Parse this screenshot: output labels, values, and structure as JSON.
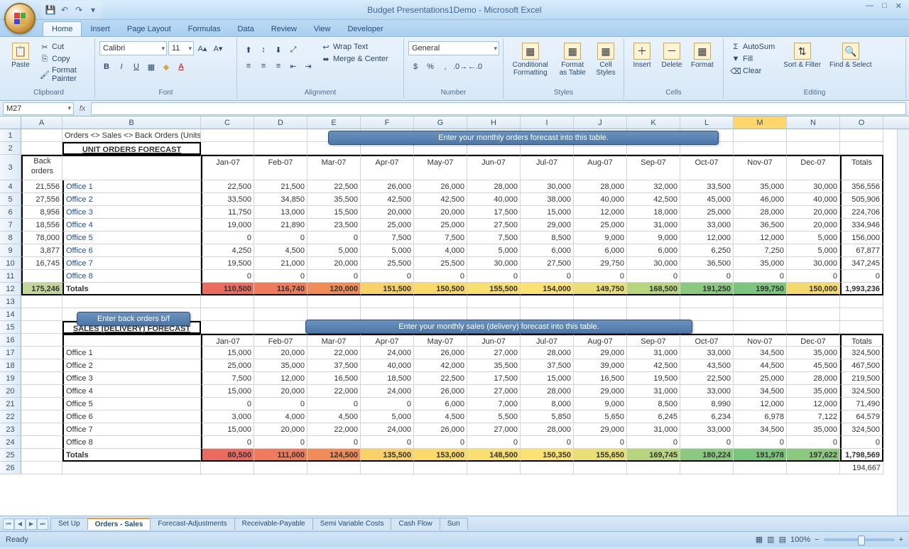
{
  "apptitle": "Budget Presentations1Demo - Microsoft Excel",
  "ribbon": {
    "tabs": [
      "Home",
      "Insert",
      "Page Layout",
      "Formulas",
      "Data",
      "Review",
      "View",
      "Developer"
    ],
    "activeTab": 0,
    "clipboard": {
      "paste": "Paste",
      "cut": "Cut",
      "copy": "Copy",
      "fmtpainter": "Format Painter",
      "label": "Clipboard"
    },
    "font": {
      "name": "Calibri",
      "size": "11",
      "label": "Font"
    },
    "alignment": {
      "wrap": "Wrap Text",
      "merge": "Merge & Center",
      "label": "Alignment"
    },
    "number": {
      "format": "General",
      "label": "Number"
    },
    "styles": {
      "cond": "Conditional\nFormatting",
      "fmttable": "Format\nas Table",
      "cellstyles": "Cell\nStyles",
      "label": "Styles"
    },
    "cells": {
      "insert": "Insert",
      "delete": "Delete",
      "format": "Format",
      "label": "Cells"
    },
    "editing": {
      "autosum": "AutoSum",
      "fill": "Fill",
      "clear": "Clear",
      "sort": "Sort &\nFilter",
      "find": "Find &\nSelect",
      "label": "Editing"
    }
  },
  "namebox": "M27",
  "cols": [
    "A",
    "B",
    "C",
    "D",
    "E",
    "F",
    "G",
    "H",
    "I",
    "J",
    "K",
    "L",
    "M",
    "N",
    "O"
  ],
  "months": [
    "Jan-07",
    "Feb-07",
    "Mar-07",
    "Apr-07",
    "May-07",
    "Jun-07",
    "Jul-07",
    "Aug-07",
    "Sep-07",
    "Oct-07",
    "Nov-07",
    "Dec-07"
  ],
  "section1_title": "Orders <> Sales <> Back Orders (Units)",
  "section1_box": "UNIT ORDERS FORECAST",
  "callout1": "Enter your monthly  orders forecast\ninto this table.",
  "backorders_hdr": "Back orders",
  "totals_hdr": "Totals",
  "orders": [
    {
      "back": "21,556",
      "name": "Office 1",
      "vals": [
        "22,500",
        "21,500",
        "22,500",
        "26,000",
        "26,000",
        "28,000",
        "30,000",
        "28,000",
        "32,000",
        "33,500",
        "35,000",
        "30,000"
      ],
      "total": "356,556"
    },
    {
      "back": "27,556",
      "name": "Office 2",
      "vals": [
        "33,500",
        "34,850",
        "35,500",
        "42,500",
        "42,500",
        "40,000",
        "38,000",
        "40,000",
        "42,500",
        "45,000",
        "46,000",
        "40,000"
      ],
      "total": "505,906"
    },
    {
      "back": "8,956",
      "name": "Office 3",
      "vals": [
        "11,750",
        "13,000",
        "15,500",
        "20,000",
        "20,000",
        "17,500",
        "15,000",
        "12,000",
        "18,000",
        "25,000",
        "28,000",
        "20,000"
      ],
      "total": "224,706"
    },
    {
      "back": "18,556",
      "name": "Office 4",
      "vals": [
        "19,000",
        "21,890",
        "23,500",
        "25,000",
        "25,000",
        "27,500",
        "29,000",
        "25,000",
        "31,000",
        "33,000",
        "36,500",
        "20,000"
      ],
      "total": "334,946"
    },
    {
      "back": "78,000",
      "name": "Office 5",
      "vals": [
        "0",
        "0",
        "0",
        "7,500",
        "7,500",
        "7,500",
        "8,500",
        "9,000",
        "9,000",
        "12,000",
        "12,000",
        "5,000"
      ],
      "total": "156,000"
    },
    {
      "back": "3,877",
      "name": "Office 6",
      "vals": [
        "4,250",
        "4,500",
        "5,000",
        "5,000",
        "4,000",
        "5,000",
        "6,000",
        "6,000",
        "6,000",
        "6,250",
        "7,250",
        "5,000"
      ],
      "total": "67,877"
    },
    {
      "back": "16,745",
      "name": "Office 7",
      "vals": [
        "19,500",
        "21,000",
        "20,000",
        "25,500",
        "25,500",
        "30,000",
        "27,500",
        "29,750",
        "30,000",
        "36,500",
        "35,000",
        "30,000"
      ],
      "total": "347,245"
    },
    {
      "back": "",
      "name": "Office 8",
      "vals": [
        "0",
        "0",
        "0",
        "0",
        "0",
        "0",
        "0",
        "0",
        "0",
        "0",
        "0",
        "0"
      ],
      "total": "0"
    }
  ],
  "orders_totals": {
    "back": "175,246",
    "name": "Totals",
    "vals": [
      "110,500",
      "116,740",
      "120,000",
      "151,500",
      "150,500",
      "155,500",
      "154,000",
      "149,750",
      "168,500",
      "191,250",
      "199,750",
      "150,000"
    ],
    "total": "1,993,236"
  },
  "callout2": "Enter back orders b/f",
  "callout3": "Enter your monthly sales\n(delivery) forecast into this table.",
  "section2_box": "SALES (DELIVERY) FORECAST",
  "sales": [
    {
      "name": "Office 1",
      "vals": [
        "15,000",
        "20,000",
        "22,000",
        "24,000",
        "26,000",
        "27,000",
        "28,000",
        "29,000",
        "31,000",
        "33,000",
        "34,500",
        "35,000"
      ],
      "total": "324,500"
    },
    {
      "name": "Office 2",
      "vals": [
        "25,000",
        "35,000",
        "37,500",
        "40,000",
        "42,000",
        "35,500",
        "37,500",
        "39,000",
        "42,500",
        "43,500",
        "44,500",
        "45,500"
      ],
      "total": "467,500"
    },
    {
      "name": "Office 3",
      "vals": [
        "7,500",
        "12,000",
        "16,500",
        "18,500",
        "22,500",
        "17,500",
        "15,000",
        "16,500",
        "19,500",
        "22,500",
        "25,000",
        "28,000"
      ],
      "total": "219,500"
    },
    {
      "name": "Office 4",
      "vals": [
        "15,000",
        "20,000",
        "22,000",
        "24,000",
        "26,000",
        "27,000",
        "28,000",
        "29,000",
        "31,000",
        "33,000",
        "34,500",
        "35,000"
      ],
      "total": "324,500"
    },
    {
      "name": "Office 5",
      "vals": [
        "0",
        "0",
        "0",
        "0",
        "6,000",
        "7,000",
        "8,000",
        "9,000",
        "8,500",
        "8,990",
        "12,000",
        "12,000"
      ],
      "total": "71,490"
    },
    {
      "name": "Office 6",
      "vals": [
        "3,000",
        "4,000",
        "4,500",
        "5,000",
        "4,500",
        "5,500",
        "5,850",
        "5,650",
        "6,245",
        "6,234",
        "6,978",
        "7,122"
      ],
      "total": "64,579"
    },
    {
      "name": "Office 7",
      "vals": [
        "15,000",
        "20,000",
        "22,000",
        "24,000",
        "26,000",
        "27,000",
        "28,000",
        "29,000",
        "31,000",
        "33,000",
        "34,500",
        "35,000"
      ],
      "total": "324,500"
    },
    {
      "name": "Office 8",
      "vals": [
        "0",
        "0",
        "0",
        "0",
        "0",
        "0",
        "0",
        "0",
        "0",
        "0",
        "0",
        "0"
      ],
      "total": "0"
    }
  ],
  "sales_totals": {
    "name": "Totals",
    "vals": [
      "80,500",
      "111,000",
      "124,500",
      "135,500",
      "153,000",
      "148,500",
      "150,350",
      "155,650",
      "169,745",
      "180,224",
      "191,978",
      "197,622"
    ],
    "total": "1,798,569"
  },
  "row26_total": "194,667",
  "sheets": [
    "Set Up",
    "Orders - Sales",
    "Forecast-Adjustments",
    "Receivable-Payable",
    "Semi Variable Costs",
    "Cash Flow",
    "Sun"
  ],
  "activeSheet": 1,
  "status": "Ready",
  "zoom": "100%",
  "chart_data": [
    {
      "type": "table",
      "title": "UNIT ORDERS FORECAST",
      "categories": [
        "Jan-07",
        "Feb-07",
        "Mar-07",
        "Apr-07",
        "May-07",
        "Jun-07",
        "Jul-07",
        "Aug-07",
        "Sep-07",
        "Oct-07",
        "Nov-07",
        "Dec-07"
      ],
      "series": [
        {
          "name": "Office 1",
          "values": [
            22500,
            21500,
            22500,
            26000,
            26000,
            28000,
            30000,
            28000,
            32000,
            33500,
            35000,
            30000
          ]
        },
        {
          "name": "Office 2",
          "values": [
            33500,
            34850,
            35500,
            42500,
            42500,
            40000,
            38000,
            40000,
            42500,
            45000,
            46000,
            40000
          ]
        },
        {
          "name": "Office 3",
          "values": [
            11750,
            13000,
            15500,
            20000,
            20000,
            17500,
            15000,
            12000,
            18000,
            25000,
            28000,
            20000
          ]
        },
        {
          "name": "Office 4",
          "values": [
            19000,
            21890,
            23500,
            25000,
            25000,
            27500,
            29000,
            25000,
            31000,
            33000,
            36500,
            20000
          ]
        },
        {
          "name": "Office 5",
          "values": [
            0,
            0,
            0,
            7500,
            7500,
            7500,
            8500,
            9000,
            9000,
            12000,
            12000,
            5000
          ]
        },
        {
          "name": "Office 6",
          "values": [
            4250,
            4500,
            5000,
            5000,
            4000,
            5000,
            6000,
            6000,
            6000,
            6250,
            7250,
            5000
          ]
        },
        {
          "name": "Office 7",
          "values": [
            19500,
            21000,
            20000,
            25500,
            25500,
            30000,
            27500,
            29750,
            30000,
            36500,
            35000,
            30000
          ]
        },
        {
          "name": "Office 8",
          "values": [
            0,
            0,
            0,
            0,
            0,
            0,
            0,
            0,
            0,
            0,
            0,
            0
          ]
        }
      ],
      "totals": [
        110500,
        116740,
        120000,
        151500,
        150500,
        155500,
        154000,
        149750,
        168500,
        191250,
        199750,
        150000
      ]
    },
    {
      "type": "table",
      "title": "SALES (DELIVERY) FORECAST",
      "categories": [
        "Jan-07",
        "Feb-07",
        "Mar-07",
        "Apr-07",
        "May-07",
        "Jun-07",
        "Jul-07",
        "Aug-07",
        "Sep-07",
        "Oct-07",
        "Nov-07",
        "Dec-07"
      ],
      "series": [
        {
          "name": "Office 1",
          "values": [
            15000,
            20000,
            22000,
            24000,
            26000,
            27000,
            28000,
            29000,
            31000,
            33000,
            34500,
            35000
          ]
        },
        {
          "name": "Office 2",
          "values": [
            25000,
            35000,
            37500,
            40000,
            42000,
            35500,
            37500,
            39000,
            42500,
            43500,
            44500,
            45500
          ]
        },
        {
          "name": "Office 3",
          "values": [
            7500,
            12000,
            16500,
            18500,
            22500,
            17500,
            15000,
            16500,
            19500,
            22500,
            25000,
            28000
          ]
        },
        {
          "name": "Office 4",
          "values": [
            15000,
            20000,
            22000,
            24000,
            26000,
            27000,
            28000,
            29000,
            31000,
            33000,
            34500,
            35000
          ]
        },
        {
          "name": "Office 5",
          "values": [
            0,
            0,
            0,
            0,
            6000,
            7000,
            8000,
            9000,
            8500,
            8990,
            12000,
            12000
          ]
        },
        {
          "name": "Office 6",
          "values": [
            3000,
            4000,
            4500,
            5000,
            4500,
            5500,
            5850,
            5650,
            6245,
            6234,
            6978,
            7122
          ]
        },
        {
          "name": "Office 7",
          "values": [
            15000,
            20000,
            22000,
            24000,
            26000,
            27000,
            28000,
            29000,
            31000,
            33000,
            34500,
            35000
          ]
        },
        {
          "name": "Office 8",
          "values": [
            0,
            0,
            0,
            0,
            0,
            0,
            0,
            0,
            0,
            0,
            0,
            0
          ]
        }
      ],
      "totals": [
        80500,
        111000,
        124500,
        135500,
        153000,
        148500,
        150350,
        155650,
        169745,
        180224,
        191978,
        197622
      ]
    }
  ]
}
